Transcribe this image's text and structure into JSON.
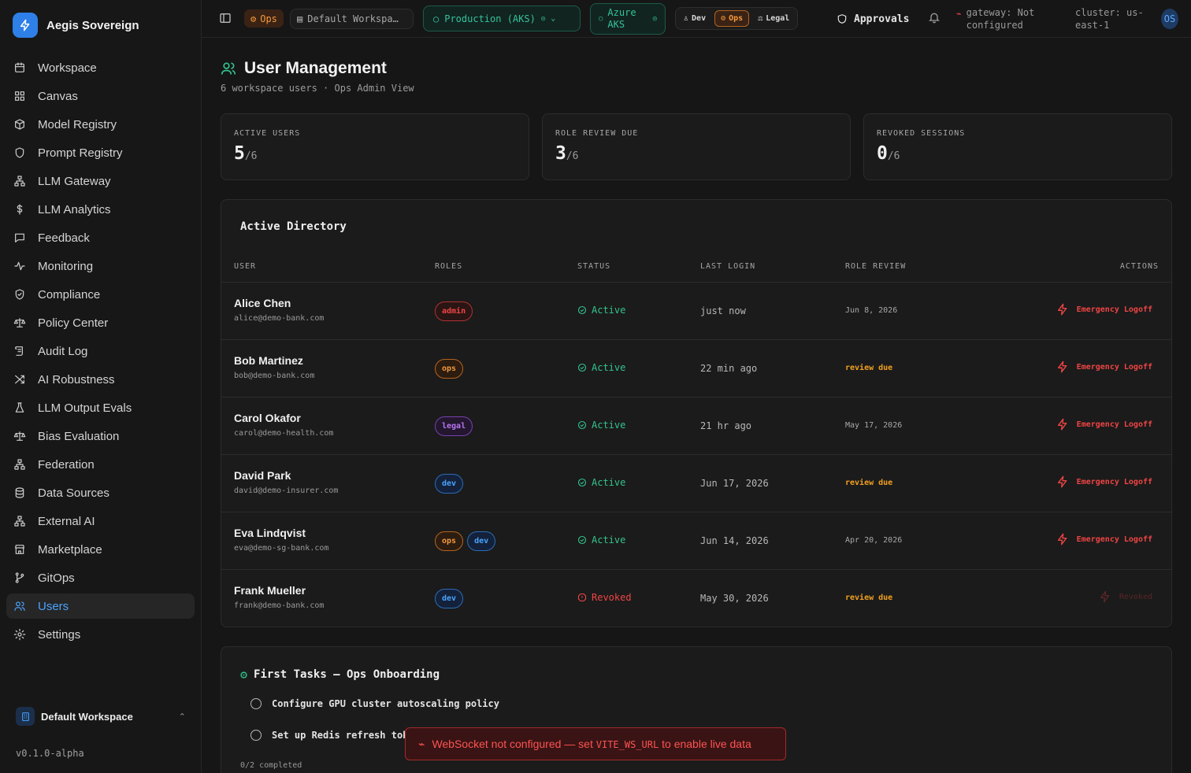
{
  "brand": {
    "name": "Aegis Sovereign",
    "accent": "#2f7fe8"
  },
  "sidebar": {
    "items": [
      {
        "label": "Workspace",
        "icon": "calendar-icon"
      },
      {
        "label": "Canvas",
        "icon": "grid-icon"
      },
      {
        "label": "Model Registry",
        "icon": "cube-icon"
      },
      {
        "label": "Prompt Registry",
        "icon": "shield-icon"
      },
      {
        "label": "LLM Gateway",
        "icon": "network-icon"
      },
      {
        "label": "LLM Analytics",
        "icon": "dollar-icon"
      },
      {
        "label": "Feedback",
        "icon": "chat-icon"
      },
      {
        "label": "Monitoring",
        "icon": "pulse-icon"
      },
      {
        "label": "Compliance",
        "icon": "shield-check-icon"
      },
      {
        "label": "Policy Center",
        "icon": "scale-icon"
      },
      {
        "label": "Audit Log",
        "icon": "scroll-icon"
      },
      {
        "label": "AI Robustness",
        "icon": "shuffle-icon"
      },
      {
        "label": "LLM Output Evals",
        "icon": "flask-icon"
      },
      {
        "label": "Bias Evaluation",
        "icon": "scale-icon"
      },
      {
        "label": "Federation",
        "icon": "network-icon"
      },
      {
        "label": "Data Sources",
        "icon": "database-icon"
      },
      {
        "label": "External AI",
        "icon": "network-icon"
      },
      {
        "label": "Marketplace",
        "icon": "store-icon"
      },
      {
        "label": "GitOps",
        "icon": "git-branch-icon"
      },
      {
        "label": "Users",
        "icon": "users-icon"
      },
      {
        "label": "Settings",
        "icon": "gear-icon"
      }
    ],
    "active": "Users",
    "workspace": "Default Workspace",
    "version": "v0.1.0-alpha"
  },
  "topbar": {
    "role_badge": "Ops",
    "workspace": "Default Workspa…",
    "environment": "Production (AKS)",
    "cloud_line1": "Azure",
    "cloud_line2": "AKS",
    "roles": [
      {
        "label": "Dev",
        "active": false
      },
      {
        "label": "Ops",
        "active": true
      },
      {
        "label": "Legal",
        "active": false
      }
    ],
    "approvals": "Approvals",
    "gateway": "gateway: Not configured",
    "cluster": "cluster: us-east-1",
    "avatar": "OS"
  },
  "page": {
    "title": "User Management",
    "subtitle": "6 workspace users · Ops Admin View"
  },
  "stats": [
    {
      "label": "ACTIVE USERS",
      "value": "5",
      "total": "/6"
    },
    {
      "label": "ROLE REVIEW DUE",
      "value": "3",
      "total": "/6"
    },
    {
      "label": "REVOKED SESSIONS",
      "value": "0",
      "total": "/6"
    }
  ],
  "directory": {
    "title": "Active Directory",
    "columns": {
      "user": "USER",
      "roles": "ROLES",
      "status": "STATUS",
      "last_login": "LAST LOGIN",
      "role_review": "ROLE REVIEW",
      "actions": "ACTIONS"
    },
    "rows": [
      {
        "name": "Alice Chen",
        "email": "alice@demo-bank.com",
        "roles": [
          "admin"
        ],
        "status": "Active",
        "last_login": "just now",
        "review": "Jun 8, 2026",
        "review_due": false,
        "action": "Emergency Logoff",
        "action_disabled": false
      },
      {
        "name": "Bob Martinez",
        "email": "bob@demo-bank.com",
        "roles": [
          "ops"
        ],
        "status": "Active",
        "last_login": "22 min ago",
        "review": "review due",
        "review_due": true,
        "action": "Emergency Logoff",
        "action_disabled": false
      },
      {
        "name": "Carol Okafor",
        "email": "carol@demo-health.com",
        "roles": [
          "legal"
        ],
        "status": "Active",
        "last_login": "21 hr ago",
        "review": "May 17, 2026",
        "review_due": false,
        "action": "Emergency Logoff",
        "action_disabled": false
      },
      {
        "name": "David Park",
        "email": "david@demo-insurer.com",
        "roles": [
          "dev"
        ],
        "status": "Active",
        "last_login": "Jun 17, 2026",
        "review": "review due",
        "review_due": true,
        "action": "Emergency Logoff",
        "action_disabled": false
      },
      {
        "name": "Eva Lindqvist",
        "email": "eva@demo-sg-bank.com",
        "roles": [
          "ops",
          "dev"
        ],
        "status": "Active",
        "last_login": "Jun 14, 2026",
        "review": "Apr 20, 2026",
        "review_due": false,
        "action": "Emergency Logoff",
        "action_disabled": false
      },
      {
        "name": "Frank Mueller",
        "email": "frank@demo-bank.com",
        "roles": [
          "dev"
        ],
        "status": "Revoked",
        "last_login": "May 30, 2026",
        "review": "review due",
        "review_due": true,
        "action": "Revoked",
        "action_disabled": true
      }
    ]
  },
  "tasks": {
    "title": "First Tasks — Ops Onboarding",
    "items": [
      "Configure GPU cluster autoscaling policy",
      "Set up Redis refresh token rotation"
    ],
    "completed": "0/2 completed"
  },
  "toast": {
    "prefix": "WebSocket not configured — set ",
    "code": "VITE_WS_URL",
    "suffix": " to enable live data",
    "color": "#ff5252"
  }
}
